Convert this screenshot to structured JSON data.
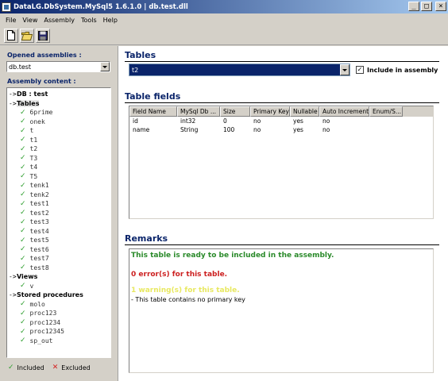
{
  "window": {
    "title": "DataLG.DbSystem.MySql5 1.6.1.0 | db.test.dll",
    "buttons": {
      "minimize": "_",
      "maximize": "□",
      "close": "×"
    }
  },
  "menu": {
    "items": [
      "File",
      "View",
      "Assembly",
      "Tools",
      "Help"
    ]
  },
  "toolbar": {
    "icons": [
      "new-file-icon",
      "open-folder-icon",
      "save-disk-icon"
    ]
  },
  "left": {
    "opened_label": "Opened assemblies :",
    "opened_value": "db.test",
    "content_label": "Assembly content :",
    "tree": [
      {
        "level": 0,
        "arrow": "->",
        "label": "DB : test"
      },
      {
        "level": 0,
        "arrow": "->",
        "label": "Tables",
        "selected": true
      },
      {
        "level": 1,
        "check": "✓",
        "label": "6prime"
      },
      {
        "level": 1,
        "check": "✓",
        "label": "onek"
      },
      {
        "level": 1,
        "check": "✓",
        "label": "t"
      },
      {
        "level": 1,
        "check": "✓",
        "label": "t1"
      },
      {
        "level": 1,
        "check": "✓",
        "label": "t2"
      },
      {
        "level": 1,
        "check": "✓",
        "label": "T3"
      },
      {
        "level": 1,
        "check": "✓",
        "label": "t4"
      },
      {
        "level": 1,
        "check": "✓",
        "label": "T5"
      },
      {
        "level": 1,
        "check": "✓",
        "label": "tenk1"
      },
      {
        "level": 1,
        "check": "✓",
        "label": "tenk2"
      },
      {
        "level": 1,
        "check": "✓",
        "label": "test1"
      },
      {
        "level": 1,
        "check": "✓",
        "label": "test2"
      },
      {
        "level": 1,
        "check": "✓",
        "label": "test3"
      },
      {
        "level": 1,
        "check": "✓",
        "label": "test4"
      },
      {
        "level": 1,
        "check": "✓",
        "label": "test5"
      },
      {
        "level": 1,
        "check": "✓",
        "label": "test6"
      },
      {
        "level": 1,
        "check": "✓",
        "label": "test7"
      },
      {
        "level": 1,
        "check": "✓",
        "label": "test8"
      },
      {
        "level": 0,
        "arrow": "->",
        "label": "Views"
      },
      {
        "level": 1,
        "check": "✓",
        "label": "v"
      },
      {
        "level": 0,
        "arrow": "->",
        "label": "Stored procedures"
      },
      {
        "level": 1,
        "check": "✓",
        "label": "molo"
      },
      {
        "level": 1,
        "check": "✓",
        "label": "proc123"
      },
      {
        "level": 1,
        "check": "✓",
        "label": "proc1234"
      },
      {
        "level": 1,
        "check": "✓",
        "label": "proc12345"
      },
      {
        "level": 1,
        "check": "✓",
        "label": "sp_out"
      }
    ],
    "legend": {
      "included_icon": "✓",
      "included": "Included",
      "excluded_icon": "✕",
      "excluded": "Excluded"
    }
  },
  "right": {
    "tables_heading": "Tables",
    "selected_table": "t2",
    "include_label": "Include in assembly",
    "include_checked": true,
    "include_mark": "✓",
    "fields_heading": "Table fields",
    "columns": [
      {
        "label": "Field Name"
      },
      {
        "label": "MySql Db ..."
      },
      {
        "label": "Size"
      },
      {
        "label": "Primary Key"
      },
      {
        "label": "Nullable"
      },
      {
        "label": "Auto Increment"
      },
      {
        "label": "Enum/S..."
      }
    ],
    "rows": [
      [
        "id",
        "int32",
        "0",
        "no",
        "yes",
        "no",
        ""
      ],
      [
        "name",
        "String",
        "100",
        "no",
        "yes",
        "no",
        ""
      ]
    ],
    "remarks_heading": "Remarks",
    "remark_ready": "This table is ready to be included in the assembly.",
    "remark_errors": "0 error(s) for this table.",
    "remark_warnings": "1 warning(s) for this table.",
    "remark_note": "- This table contains no primary key"
  },
  "colors": {
    "title_start": "#0a246a",
    "title_end": "#a6caf0",
    "heading": "#0a246a",
    "included": "#2e9e2e",
    "excluded": "#d42020",
    "errors": "#cc2020",
    "warnings": "#e8e860"
  }
}
